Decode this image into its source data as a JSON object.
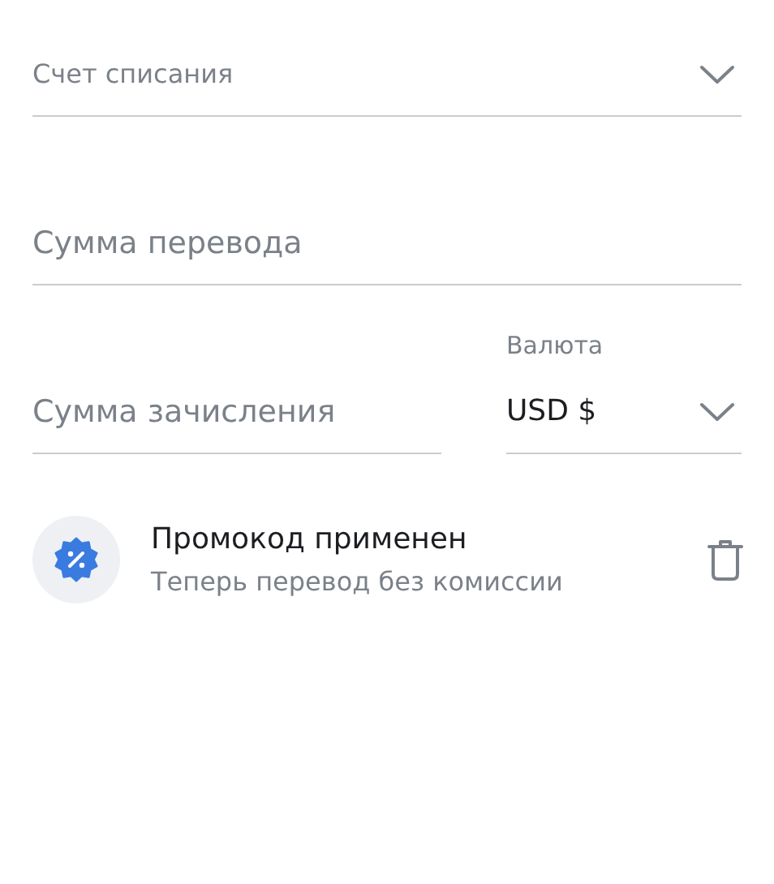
{
  "account_field": {
    "placeholder": "Счет списания"
  },
  "transfer_amount": {
    "placeholder": "Сумма перевода"
  },
  "credit_amount": {
    "placeholder": "Сумма зачисления"
  },
  "currency_field": {
    "label": "Валюта",
    "value": "USD $"
  },
  "promo": {
    "title": "Промокод применен",
    "subtitle": "Теперь перевод без комиссии"
  }
}
